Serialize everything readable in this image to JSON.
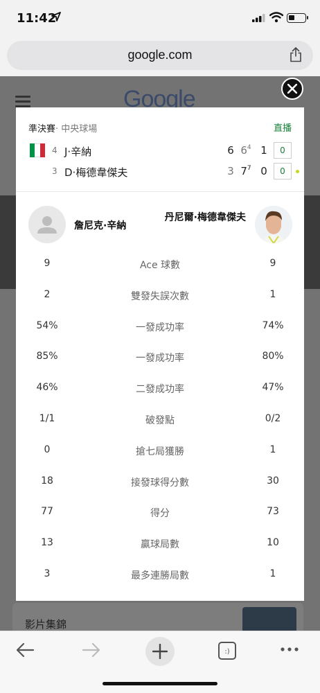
{
  "status_bar": {
    "time": "11:42"
  },
  "browser": {
    "url": "google.com"
  },
  "background": {
    "logo": "Google",
    "video_card_title": "影片集錦"
  },
  "match": {
    "round": "準決賽",
    "venue": "· 中央球場",
    "live_label": "直播",
    "players": [
      {
        "seed": "4",
        "short_name": "J·辛納",
        "flag": "italy",
        "sets": [
          "6",
          "6",
          "1"
        ],
        "tiebreak": [
          "",
          "4",
          ""
        ],
        "points": "0",
        "serving": false
      },
      {
        "seed": "3",
        "short_name": "D·梅德韋傑夫",
        "flag": "",
        "sets": [
          "3",
          "7",
          "0"
        ],
        "tiebreak": [
          "",
          "7",
          ""
        ],
        "points": "0",
        "serving": true
      }
    ]
  },
  "head_to_head": {
    "player1_full": "詹尼克·辛納",
    "player2_full": "丹尼爾·梅德韋傑夫",
    "stats": [
      {
        "label": "Ace 球數",
        "p1": "9",
        "p2": "9"
      },
      {
        "label": "雙發失誤次數",
        "p1": "2",
        "p2": "1"
      },
      {
        "label": "一發成功率",
        "p1": "54%",
        "p2": "74%"
      },
      {
        "label": "一發成功率",
        "p1": "85%",
        "p2": "80%"
      },
      {
        "label": "二發成功率",
        "p1": "46%",
        "p2": "47%"
      },
      {
        "label": "破發點",
        "p1": "1/1",
        "p2": "0/2"
      },
      {
        "label": "搶七局獲勝",
        "p1": "0",
        "p2": "1"
      },
      {
        "label": "接發球得分數",
        "p1": "18",
        "p2": "30"
      },
      {
        "label": "得分",
        "p1": "77",
        "p2": "73"
      },
      {
        "label": "贏球局數",
        "p1": "13",
        "p2": "10"
      },
      {
        "label": "最多連勝局數",
        "p1": "3",
        "p2": "1"
      }
    ]
  },
  "colors": {
    "live_green": "#188038",
    "serve_dot": "#c5d91e",
    "overlay": "#737373"
  },
  "icons": [
    "location-arrow-icon",
    "signal-icon",
    "wifi-icon",
    "battery-icon",
    "share-icon",
    "close-icon",
    "back-icon",
    "forward-icon",
    "plus-icon",
    "tabs-icon",
    "more-icon"
  ]
}
